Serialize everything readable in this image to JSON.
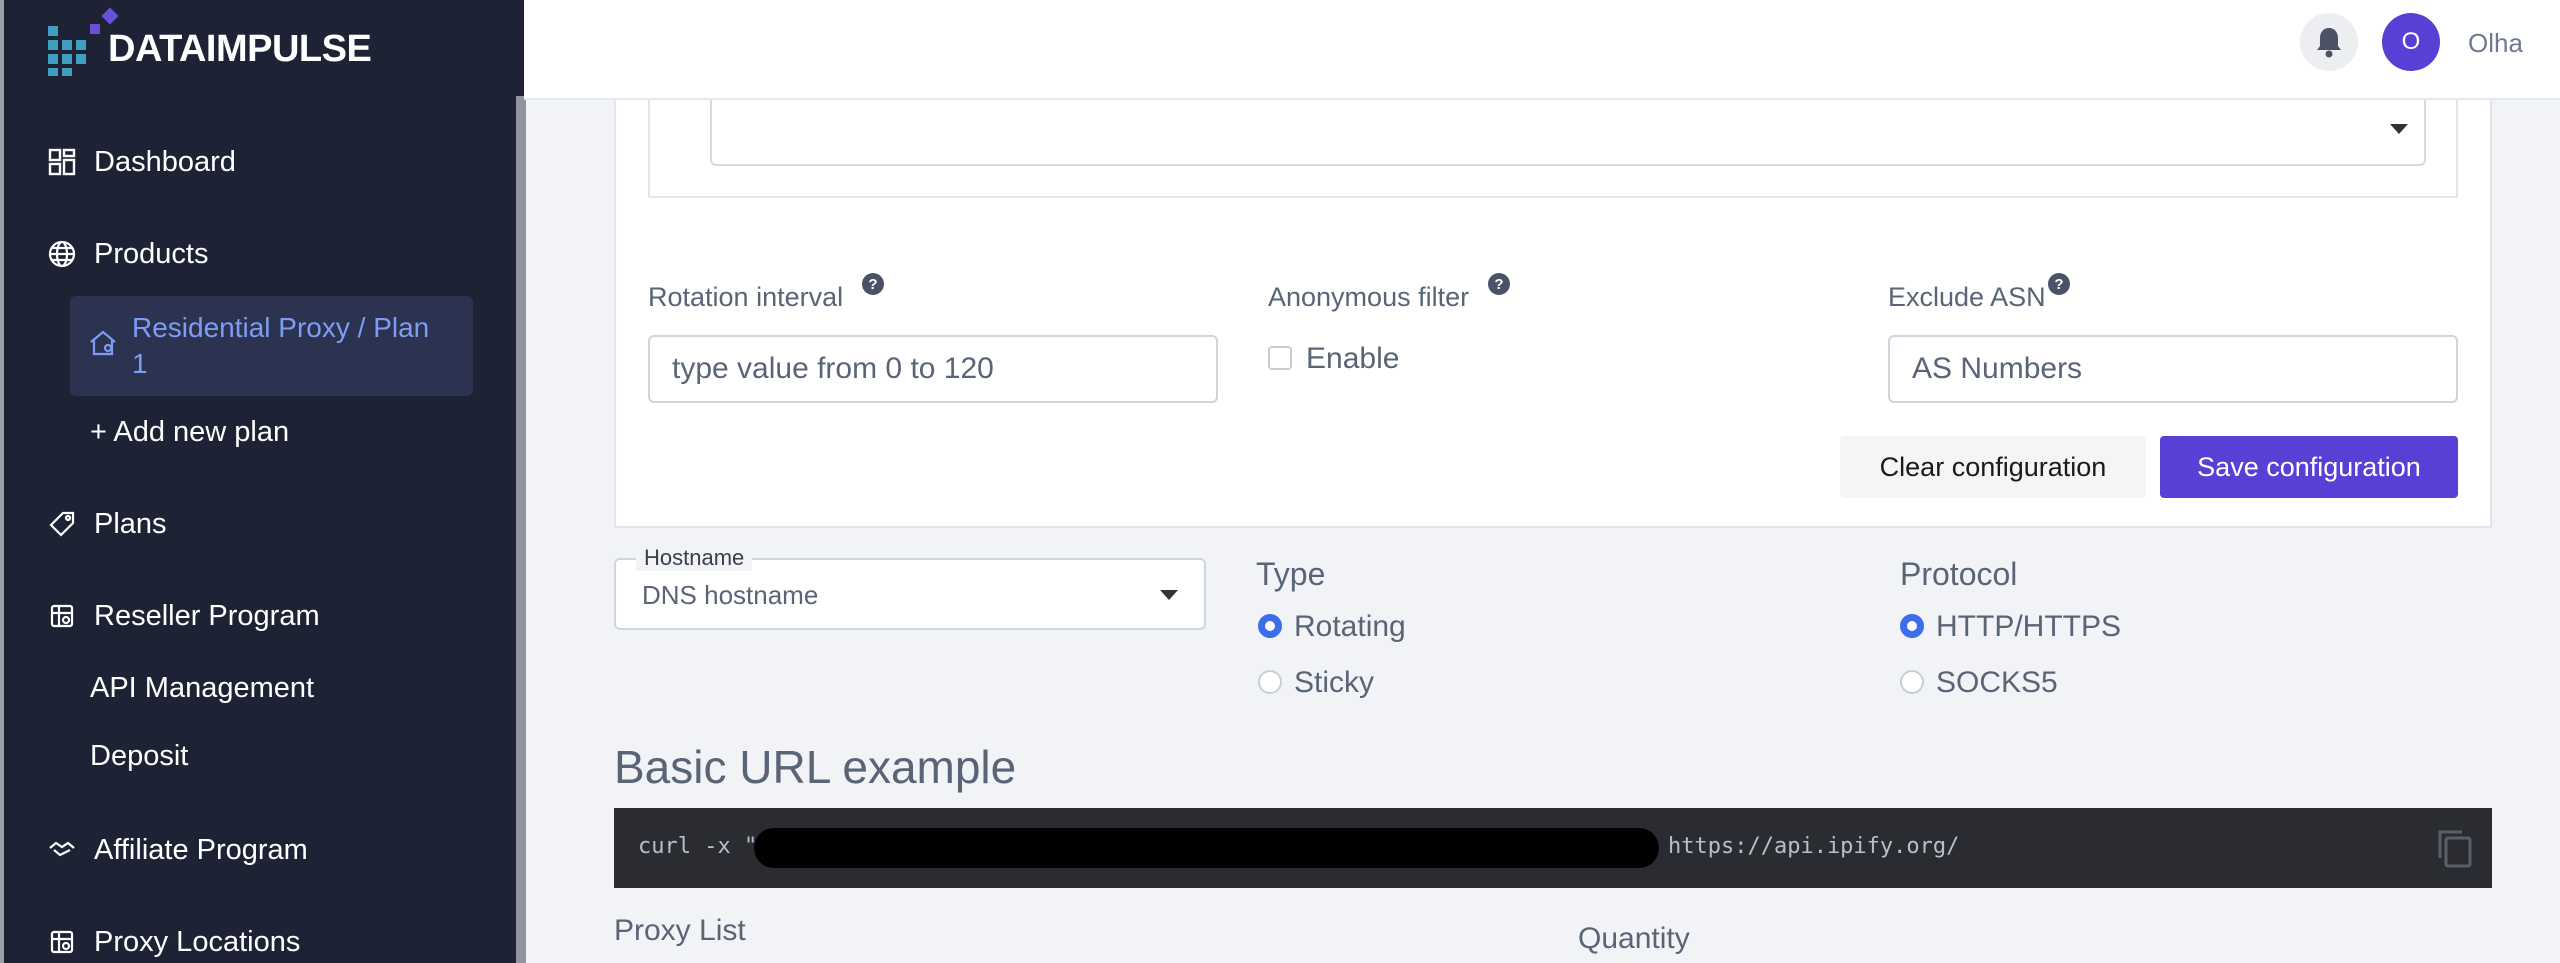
{
  "brand": {
    "name": "DATAIMPULSE"
  },
  "sidebar": {
    "dashboard": "Dashboard",
    "products": "Products",
    "active_plan": "Residential Proxy / Plan 1",
    "add_plan": "+ Add new plan",
    "plans": "Plans",
    "reseller": "Reseller Program",
    "api_management": "API Management",
    "deposit": "Deposit",
    "affiliate": "Affiliate Program",
    "proxy_locations": "Proxy Locations"
  },
  "header": {
    "avatar_initial": "O",
    "username": "Olha"
  },
  "config": {
    "rotation_label": "Rotation interval",
    "rotation_placeholder": "type value from 0 to 120",
    "anon_label": "Anonymous filter",
    "anon_checkbox": "Enable",
    "asn_label": "Exclude ASN",
    "asn_placeholder": "AS Numbers",
    "help": "?",
    "clear": "Clear configuration",
    "save": "Save configuration"
  },
  "hostname": {
    "legend": "Hostname",
    "value": "DNS hostname"
  },
  "type": {
    "title": "Type",
    "options": [
      "Rotating",
      "Sticky"
    ],
    "selected": "Rotating"
  },
  "protocol": {
    "title": "Protocol",
    "options": [
      "HTTP/HTTPS",
      "SOCKS5"
    ],
    "selected": "HTTP/HTTPS"
  },
  "example": {
    "title": "Basic URL example",
    "code_prefix": "curl -x \"",
    "code_suffix": " https://api.ipify.org/"
  },
  "bottom": {
    "proxy_list": "Proxy List",
    "quantity": "Quantity"
  },
  "colors": {
    "sidebar_bg": "#1e2235",
    "accent": "#5840d6",
    "radio": "#3b6ee8",
    "active_text": "#7f9cf5"
  }
}
